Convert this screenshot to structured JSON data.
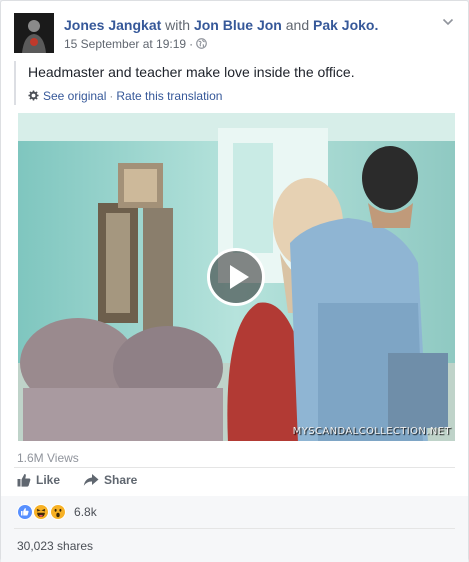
{
  "header": {
    "author": "Jones Jangkat",
    "with_word": "with",
    "tagged_1": "Jon Blue Jon",
    "and_word": "and",
    "tagged_2": "Pak Joko.",
    "timestamp": "15 September at 19:19",
    "dot": "·"
  },
  "post": {
    "text": "Headmaster and teacher make love inside the office.",
    "see_original": "See original",
    "separator": "·",
    "rate_translation": "Rate this translation"
  },
  "video": {
    "watermark": "MYSCANDALCOLLECTION.NET"
  },
  "stats": {
    "views": "1.6M Views",
    "reaction_count": "6.8k",
    "shares": "30,023 shares"
  },
  "actions": {
    "like": "Like",
    "share": "Share"
  },
  "colors": {
    "link": "#365899",
    "secondary_text": "#616770",
    "like_blue": "#5890ff",
    "haha_yellow": "#f7b125"
  },
  "icons": [
    "avatar",
    "globe-icon",
    "chevron-down-icon",
    "gear-icon",
    "play-icon",
    "like-icon",
    "share-icon",
    "like-reaction-icon",
    "haha-reaction-icon",
    "wow-reaction-icon"
  ]
}
